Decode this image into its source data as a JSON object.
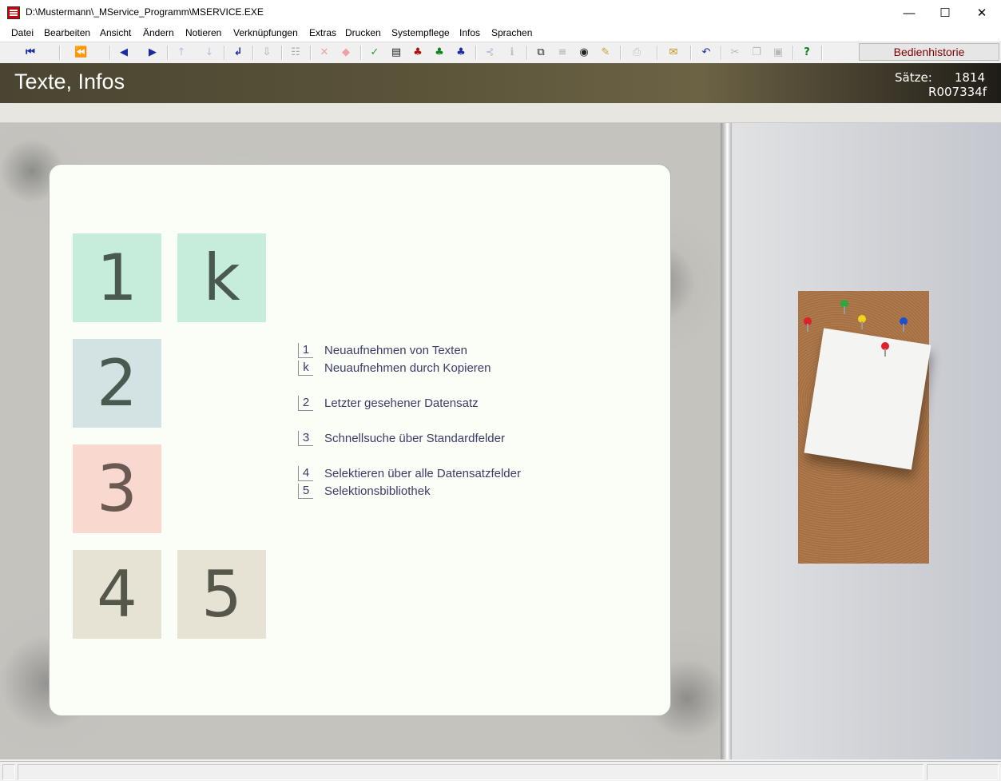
{
  "window": {
    "title": "D:\\Mustermann\\_MService_Programm\\MSERVICE.EXE",
    "minimize_glyph": "—",
    "maximize_glyph": "☐",
    "close_glyph": "✕"
  },
  "menu": [
    "Datei",
    "Bearbeiten",
    "Ansicht",
    "Ändern",
    "Notieren",
    "Verknüpfungen",
    "Extras",
    "Drucken",
    "Systempflege",
    "Infos",
    "Sprachen"
  ],
  "toolbar": {
    "history_button": "Bedienhistorie",
    "icons": [
      "first-record-icon",
      "previous-page-icon",
      "previous-record-icon",
      "next-record-icon",
      "move-up-icon",
      "move-down-icon",
      "enter-icon",
      "import-icon",
      "insert-icon",
      "delete-icon",
      "eraser-icon",
      "confirm-check-icon",
      "form-view-icon",
      "red-frog-icon",
      "green-frog-icon",
      "blue-frog-icon",
      "link-icon",
      "info-icon",
      "binoculars-icon",
      "list-icon",
      "eye-icon",
      "pencil-icon",
      "printer-icon",
      "mail-icon",
      "undo-icon",
      "cut-icon",
      "copy-icon",
      "paste-icon",
      "help-icon"
    ]
  },
  "header": {
    "title": "Texte, Infos",
    "count_label": "Sätze:",
    "count_value": "1814",
    "record_id": "R007334f"
  },
  "tiles": [
    {
      "key": "1",
      "color": "#c6ecdb"
    },
    {
      "key": "k",
      "color": "#c6ecdb"
    },
    {
      "key": "2",
      "color": "#d3e3e3"
    },
    {
      "key": "3",
      "color": "#f8d8cf"
    },
    {
      "key": "4",
      "color": "#e6e3d4"
    },
    {
      "key": "5",
      "color": "#e6e3d4"
    }
  ],
  "options": [
    {
      "key": "1",
      "label": "Neuaufnehmen von Texten"
    },
    {
      "key": "k",
      "label": "Neuaufnehmen durch Kopieren"
    },
    {
      "key": "2",
      "label": "Letzter gesehener Datensatz"
    },
    {
      "key": "3",
      "label": "Schnellsuche über Standardfelder"
    },
    {
      "key": "4",
      "label": "Selektieren über alle Datensatzfelder"
    },
    {
      "key": "5",
      "label": "Selektionsbibliothek"
    }
  ],
  "colors": {
    "accent_text": "#3c3c6a",
    "history_text": "#800000"
  }
}
